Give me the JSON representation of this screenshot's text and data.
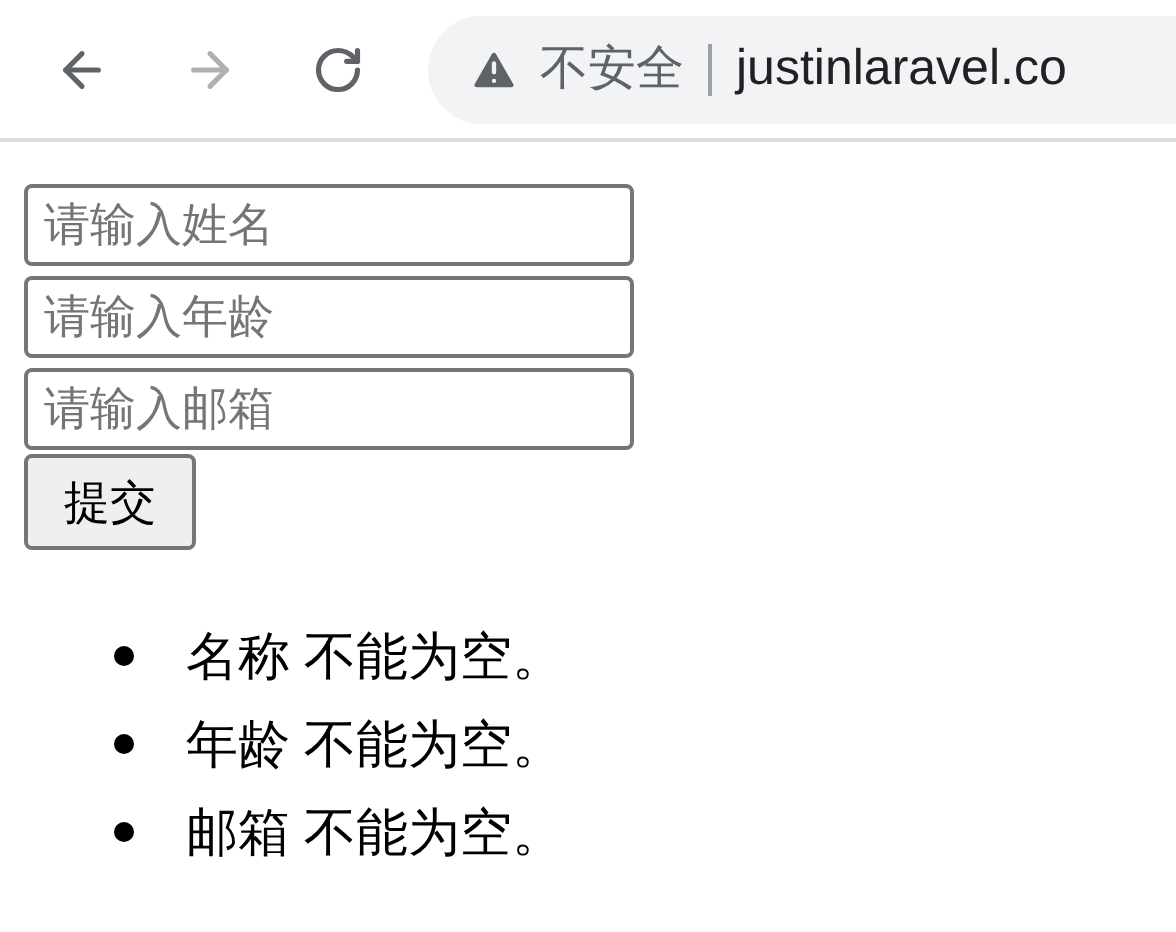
{
  "toolbar": {
    "back": {
      "disabled": false
    },
    "forward": {
      "disabled": true
    },
    "security_label": "不安全",
    "url": "justinlaravel.co"
  },
  "form": {
    "fields": [
      {
        "placeholder": "请输入姓名"
      },
      {
        "placeholder": "请输入年龄"
      },
      {
        "placeholder": "请输入邮箱"
      }
    ],
    "submit": "提交"
  },
  "errors": [
    {
      "field": "名称",
      "message": "不能为空。"
    },
    {
      "field": "年龄",
      "message": "不能为空。"
    },
    {
      "field": "邮箱",
      "message": "不能为空。"
    }
  ]
}
